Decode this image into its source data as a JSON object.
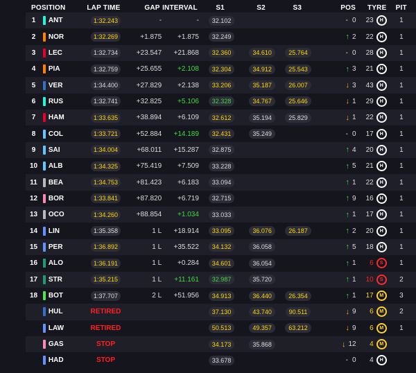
{
  "header": {
    "position": "POSITION",
    "lap_time": "LAP TIME",
    "gap": "GAP",
    "interval": "INTERVAL",
    "s1": "S1",
    "s2": "S2",
    "s3": "S3",
    "pos": "POS",
    "tyre": "TYRE",
    "pit": "PIT"
  },
  "team_colors": {
    "mercedes": "#27f4d2",
    "ferrari": "#e8002d",
    "mclaren": "#ff8000",
    "redbull": "#3671c6",
    "sauber": "#52e252",
    "williams": "#64c4ff",
    "haas": "#b6babd",
    "alpine": "#ff87bc",
    "astonmartin": "#229971",
    "racingbulls": "#6692ff"
  },
  "rows": [
    {
      "pos": "1",
      "team": "#27f4d2",
      "driver": "ANT",
      "lap": "1:32.243",
      "lap_c": "y",
      "gap": "-",
      "int": "-",
      "int_c": "w",
      "s1": "32.102",
      "s1_c": "w",
      "s2": "",
      "s2_c": "w",
      "s3": "",
      "s3_c": "w",
      "change_dir": "none",
      "change": "0",
      "laps": "23",
      "tyre": "H",
      "pit": "1"
    },
    {
      "pos": "2",
      "team": "#ff8000",
      "driver": "NOR",
      "lap": "1:32.269",
      "lap_c": "y",
      "gap": "+1.875",
      "int": "+1.875",
      "int_c": "w",
      "s1": "32.249",
      "s1_c": "w",
      "s2": "",
      "s2_c": "w",
      "s3": "",
      "s3_c": "w",
      "change_dir": "up",
      "change": "2",
      "laps": "22",
      "tyre": "H",
      "pit": "1"
    },
    {
      "pos": "3",
      "team": "#e8002d",
      "driver": "LEC",
      "lap": "1:32.734",
      "lap_c": "w",
      "gap": "+23.547",
      "int": "+21.868",
      "int_c": "w",
      "s1": "32.360",
      "s1_c": "y",
      "s2": "34.610",
      "s2_c": "y",
      "s3": "25.764",
      "s3_c": "y",
      "change_dir": "none",
      "change": "0",
      "laps": "28",
      "tyre": "H",
      "pit": "1"
    },
    {
      "pos": "4",
      "team": "#ff8000",
      "driver": "PIA",
      "lap": "1:32.759",
      "lap_c": "w",
      "gap": "+25.655",
      "int": "+2.108",
      "int_c": "g",
      "s1": "32.304",
      "s1_c": "y",
      "s2": "34.912",
      "s2_c": "y",
      "s3": "25.543",
      "s3_c": "y",
      "change_dir": "up",
      "change": "3",
      "laps": "21",
      "tyre": "H",
      "pit": "1"
    },
    {
      "pos": "5",
      "team": "#3671c6",
      "driver": "VER",
      "lap": "1:34.400",
      "lap_c": "w",
      "gap": "+27.829",
      "int": "+2.138",
      "int_c": "w",
      "s1": "33.206",
      "s1_c": "y",
      "s2": "35.187",
      "s2_c": "y",
      "s3": "26.007",
      "s3_c": "y",
      "change_dir": "down",
      "change": "3",
      "laps": "43",
      "tyre": "H",
      "pit": "1"
    },
    {
      "pos": "6",
      "team": "#27f4d2",
      "driver": "RUS",
      "lap": "1:32.741",
      "lap_c": "w",
      "gap": "+32.825",
      "int": "+5.106",
      "int_c": "g",
      "s1": "32.328",
      "s1_c": "g",
      "s2": "34.767",
      "s2_c": "y",
      "s3": "25.646",
      "s3_c": "y",
      "change_dir": "down",
      "change": "1",
      "laps": "29",
      "tyre": "H",
      "pit": "1"
    },
    {
      "pos": "7",
      "team": "#e8002d",
      "driver": "HAM",
      "lap": "1:33.635",
      "lap_c": "y",
      "gap": "+38.894",
      "int": "+6.109",
      "int_c": "w",
      "s1": "32.612",
      "s1_c": "y",
      "s2": "35.194",
      "s2_c": "w",
      "s3": "25.829",
      "s3_c": "w",
      "change_dir": "down",
      "change": "1",
      "laps": "22",
      "tyre": "H",
      "pit": "1"
    },
    {
      "pos": "8",
      "team": "#64c4ff",
      "driver": "COL",
      "lap": "1:33.721",
      "lap_c": "y",
      "gap": "+52.884",
      "int": "+14.189",
      "int_c": "g",
      "s1": "32.431",
      "s1_c": "y",
      "s2": "35.249",
      "s2_c": "w",
      "s3": "",
      "s3_c": "w",
      "change_dir": "none",
      "change": "0",
      "laps": "17",
      "tyre": "H",
      "pit": "1"
    },
    {
      "pos": "9",
      "team": "#64c4ff",
      "driver": "SAI",
      "lap": "1:34.004",
      "lap_c": "y",
      "gap": "+68.011",
      "int": "+15.287",
      "int_c": "w",
      "s1": "32.875",
      "s1_c": "w",
      "s2": "",
      "s2_c": "w",
      "s3": "",
      "s3_c": "w",
      "change_dir": "up",
      "change": "4",
      "laps": "20",
      "tyre": "H",
      "pit": "1"
    },
    {
      "pos": "10",
      "team": "#64c4ff",
      "driver": "ALB",
      "lap": "1:34.325",
      "lap_c": "y",
      "gap": "+75.419",
      "int": "+7.509",
      "int_c": "w",
      "s1": "33.228",
      "s1_c": "w",
      "s2": "",
      "s2_c": "w",
      "s3": "",
      "s3_c": "w",
      "change_dir": "up",
      "change": "5",
      "laps": "21",
      "tyre": "H",
      "pit": "1"
    },
    {
      "pos": "11",
      "team": "#b6babd",
      "driver": "BEA",
      "lap": "1:34.753",
      "lap_c": "y",
      "gap": "+81.423",
      "int": "+6.183",
      "int_c": "w",
      "s1": "33.094",
      "s1_c": "w",
      "s2": "",
      "s2_c": "w",
      "s3": "",
      "s3_c": "w",
      "change_dir": "up",
      "change": "1",
      "laps": "22",
      "tyre": "H",
      "pit": "1"
    },
    {
      "pos": "12",
      "team": "#ff87bc",
      "driver": "BOR",
      "lap": "1:33.841",
      "lap_c": "y",
      "gap": "+87.820",
      "int": "+6.719",
      "int_c": "w",
      "s1": "32.715",
      "s1_c": "w",
      "s2": "",
      "s2_c": "w",
      "s3": "",
      "s3_c": "w",
      "change_dir": "up",
      "change": "9",
      "laps": "16",
      "tyre": "H",
      "pit": "1"
    },
    {
      "pos": "13",
      "team": "#b6babd",
      "driver": "OCO",
      "lap": "1:34.260",
      "lap_c": "y",
      "gap": "+88.854",
      "int": "+1.034",
      "int_c": "g",
      "s1": "33.033",
      "s1_c": "w",
      "s2": "",
      "s2_c": "w",
      "s3": "",
      "s3_c": "w",
      "change_dir": "up",
      "change": "1",
      "laps": "17",
      "tyre": "H",
      "pit": "1"
    },
    {
      "pos": "14",
      "team": "#6692ff",
      "driver": "LIN",
      "lap": "1:35.358",
      "lap_c": "w",
      "gap": "1 L",
      "int": "+18.914",
      "int_c": "w",
      "s1": "33.095",
      "s1_c": "y",
      "s2": "36.076",
      "s2_c": "y",
      "s3": "26.187",
      "s3_c": "y",
      "change_dir": "up",
      "change": "2",
      "laps": "20",
      "tyre": "H",
      "pit": "1"
    },
    {
      "pos": "15",
      "team": "#6692ff",
      "driver": "PER",
      "lap": "1:36.892",
      "lap_c": "y",
      "gap": "1 L",
      "int": "+35.522",
      "int_c": "w",
      "s1": "34.132",
      "s1_c": "y",
      "s2": "36.058",
      "s2_c": "w",
      "s3": "",
      "s3_c": "w",
      "change_dir": "up",
      "change": "5",
      "laps": "18",
      "tyre": "H",
      "pit": "1"
    },
    {
      "pos": "16",
      "team": "#229971",
      "driver": "ALO",
      "lap": "1:36.191",
      "lap_c": "y",
      "gap": "1 L",
      "int": "+0.284",
      "int_c": "w",
      "s1": "34.601",
      "s1_c": "y",
      "s2": "36.054",
      "s2_c": "w",
      "s3": "",
      "s3_c": "w",
      "change_dir": "up",
      "change": "1",
      "laps": "6",
      "tyre": "S",
      "pit": "1"
    },
    {
      "pos": "17",
      "team": "#229971",
      "driver": "STR",
      "lap": "1:35.215",
      "lap_c": "y",
      "gap": "1 L",
      "int": "+11.161",
      "int_c": "g",
      "s1": "32.987",
      "s1_c": "g",
      "s2": "35.720",
      "s2_c": "w",
      "s3": "",
      "s3_c": "w",
      "change_dir": "up",
      "change": "1",
      "laps": "10",
      "tyre": "S",
      "pit": "2"
    },
    {
      "pos": "18",
      "team": "#52e252",
      "driver": "BOT",
      "lap": "1:37.707",
      "lap_c": "w",
      "gap": "2 L",
      "int": "+51.956",
      "int_c": "w",
      "s1": "34.913",
      "s1_c": "y",
      "s2": "36.440",
      "s2_c": "y",
      "s3": "26.354",
      "s3_c": "y",
      "change_dir": "up",
      "change": "1",
      "laps": "17",
      "tyre": "M",
      "pit": "3"
    },
    {
      "pos": "",
      "team": "#3671c6",
      "driver": "HUL",
      "lap": "",
      "status": "RETIRED",
      "gap": "",
      "int": "",
      "int_c": "w",
      "s1": "37.130",
      "s1_c": "y",
      "s2": "43.740",
      "s2_c": "y",
      "s3": "90.511",
      "s3_c": "y",
      "change_dir": "down",
      "change": "9",
      "laps": "6",
      "tyre": "M",
      "pit": "2"
    },
    {
      "pos": "",
      "team": "#6692ff",
      "driver": "LAW",
      "lap": "",
      "status": "RETIRED",
      "gap": "",
      "int": "",
      "int_c": "w",
      "s1": "50.513",
      "s1_c": "y",
      "s2": "49.357",
      "s2_c": "y",
      "s3": "63.212",
      "s3_c": "y",
      "change_dir": "down",
      "change": "9",
      "laps": "6",
      "tyre": "M",
      "pit": "1"
    },
    {
      "pos": "",
      "team": "#ff87bc",
      "driver": "GAS",
      "lap": "",
      "status": "STOP",
      "gap": "",
      "int": "",
      "int_c": "w",
      "s1": "34.173",
      "s1_c": "y",
      "s2": "35.868",
      "s2_c": "w",
      "s3": "",
      "s3_c": "w",
      "change_dir": "down",
      "change": "12",
      "laps": "4",
      "tyre": "M",
      "pit": ""
    },
    {
      "pos": "",
      "team": "#6692ff",
      "driver": "HAD",
      "lap": "",
      "status": "STOP",
      "gap": "",
      "int": "",
      "int_c": "w",
      "s1": "33.678",
      "s1_c": "w",
      "s2": "",
      "s2_c": "w",
      "s3": "",
      "s3_c": "w",
      "change_dir": "none",
      "change": "0",
      "laps": "4",
      "tyre": "H",
      "pit": ""
    }
  ]
}
